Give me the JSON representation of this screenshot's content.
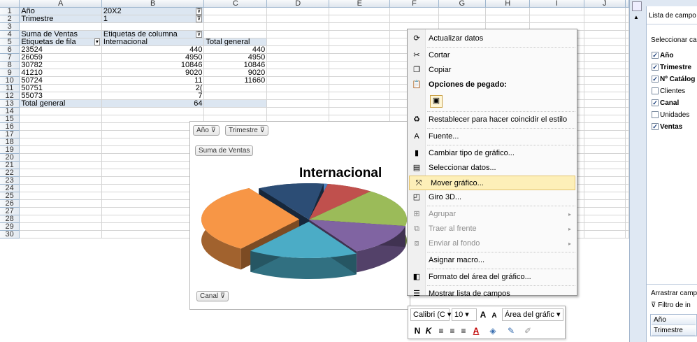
{
  "columns": [
    "A",
    "B",
    "C",
    "D",
    "E",
    "F",
    "G",
    "H",
    "I",
    "J"
  ],
  "rows": [
    "1",
    "2",
    "3",
    "4",
    "5",
    "6",
    "7",
    "8",
    "9",
    "10",
    "11",
    "12",
    "13",
    "14",
    "15",
    "16",
    "17",
    "18",
    "19",
    "20",
    "21",
    "22",
    "23",
    "24",
    "25",
    "26",
    "27",
    "28",
    "29",
    "30"
  ],
  "pivot": {
    "filter1_label": "Año",
    "filter1_value": "20X2",
    "filter2_label": "Trimestre",
    "filter2_value": "1",
    "values_label": "Suma de Ventas",
    "col_labels": "Etiquetas de columna",
    "row_labels": "Etiquetas de fila",
    "col_internacional": "Internacional",
    "col_total": "Total general",
    "data": [
      {
        "a": "23524",
        "b": "440",
        "c": "440"
      },
      {
        "a": "26059",
        "b": "4950",
        "c": "4950"
      },
      {
        "a": "30782",
        "b": "10846",
        "c": "10846"
      },
      {
        "a": "41210",
        "b": "9020",
        "c": "9020"
      },
      {
        "a": "50724",
        "b": "11",
        "c": "11660"
      },
      {
        "a": "50751",
        "b": "2(",
        "c": ""
      },
      {
        "a": "55073",
        "b": "7",
        "c": ""
      }
    ],
    "total_label": "Total general",
    "total_b": "64",
    "total_c": ""
  },
  "chart": {
    "title": "Internacional",
    "btn_year": "Año",
    "btn_quarter": "Trimestre",
    "btn_values": "Suma de Ventas",
    "btn_channel": "Canal",
    "filter_icon": "funnel-icon"
  },
  "chart_data": {
    "type": "pie",
    "title": "Internacional",
    "categories": [
      "23524",
      "26059",
      "30782",
      "41210",
      "50724",
      "50751",
      "55073"
    ],
    "values": [
      440,
      4950,
      10846,
      9020,
      11660,
      20000,
      7000
    ],
    "colors": [
      "#4f81bd",
      "#c0504d",
      "#9bbb59",
      "#8064a2",
      "#4bacc6",
      "#f79646",
      "#2c4d75"
    ]
  },
  "context_menu": [
    {
      "label": "Actualizar datos",
      "icon": "refresh-icon",
      "sep_after": true
    },
    {
      "label": "Cortar",
      "icon": "scissors-icon"
    },
    {
      "label": "Copiar",
      "icon": "copy-icon"
    },
    {
      "label": "Opciones de pegado:",
      "icon": "paste-icon",
      "header": true
    },
    {
      "label": "",
      "icon": "paste-option-icon",
      "sep_after": true
    },
    {
      "label": "Restablecer para hacer coincidir el estilo",
      "icon": "reset-style-icon",
      "sep_after": true
    },
    {
      "label": "Fuente...",
      "icon": "font-icon",
      "sep_after": true
    },
    {
      "label": "Cambiar tipo de gráfico...",
      "icon": "chart-type-icon"
    },
    {
      "label": "Seleccionar datos...",
      "icon": "select-data-icon"
    },
    {
      "label": "Mover gráfico...",
      "icon": "move-chart-icon",
      "highlight": true
    },
    {
      "label": "Giro 3D...",
      "icon": "rotate-3d-icon",
      "sep_after": true
    },
    {
      "label": "Agrupar",
      "icon": "group-icon",
      "disabled": true,
      "submenu": true
    },
    {
      "label": "Traer al frente",
      "icon": "bring-front-icon",
      "disabled": true,
      "submenu": true
    },
    {
      "label": "Enviar al fondo",
      "icon": "send-back-icon",
      "disabled": true,
      "submenu": true,
      "sep_after": true
    },
    {
      "label": "Asignar macro...",
      "icon": "",
      "sep_after": true
    },
    {
      "label": "Formato del área del gráfico...",
      "icon": "format-area-icon",
      "sep_after": true
    },
    {
      "label": "Mostrar lista de campos",
      "icon": "field-list-icon"
    }
  ],
  "mini_toolbar": {
    "font": "Calibri (C",
    "size": "10",
    "grow": "A",
    "shrink": "A",
    "area": "Área del gráfic",
    "bold": "N",
    "italic": "K"
  },
  "field_pane": {
    "title": "Lista de campo",
    "select": "Seleccionar cam",
    "fields": [
      {
        "label": "Año",
        "checked": true
      },
      {
        "label": "Trimestre",
        "checked": true
      },
      {
        "label": "Nº Catálog",
        "checked": true
      },
      {
        "label": "Clientes",
        "checked": false
      },
      {
        "label": "Canal",
        "checked": true
      },
      {
        "label": "Unidades",
        "checked": false
      },
      {
        "label": "Ventas",
        "checked": true
      }
    ],
    "drag": "Arrastrar campo",
    "filter_label": "Filtro de in",
    "filter_items": [
      "Año",
      "Trimestre"
    ]
  }
}
